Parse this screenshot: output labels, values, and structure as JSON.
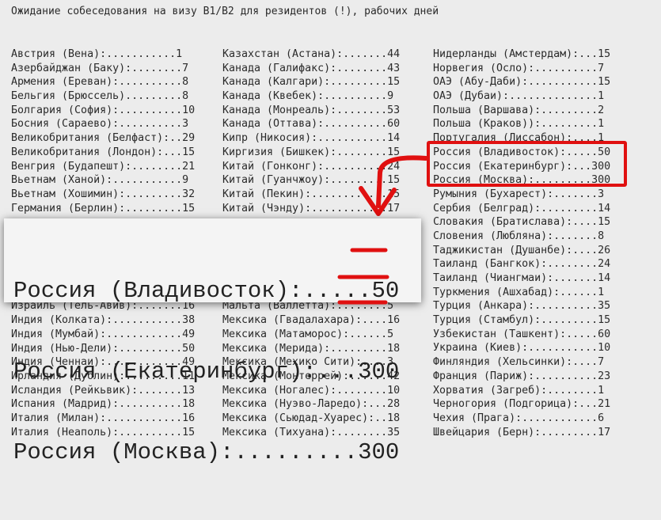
{
  "title": "Ожидание собеседования на визу B1/B2 для резидентов (!), рабочих дней",
  "columns": [
    [
      "Австрия (Вена):...........1",
      "Азербайджан (Баку):........7",
      "Армения (Ереван):..........8",
      "Бельгия (Брюссель).........8",
      "Болгария (София):..........10",
      "Босния (Сараево):..........3",
      "Великобритания (Белфаст):..29",
      "Великобритания (Лондон):...15",
      "Венгрия (Будапешт):........21",
      "Вьетнам (Ханой):...........9",
      "Вьетнам (Хошимин):.........32",
      "Германия (Берлин):.........15",
      "Израиль (Тель-Авив):.......16",
      "Индия (Колката):...........38",
      "Индия (Мумбай):............49",
      "Индия (Нью-Дели):..........50",
      "Индия (Ченнаи):............49",
      "Ирландия (Дублин):.........11",
      "Исландия (Рейкьвик):.......13",
      "Испания (Мадрид):..........18",
      "Италия (Милан):............16",
      "Италия (Неаполь):..........15"
    ],
    [
      "Казахстан (Астана):.......44",
      "Канада (Галифакс):........43",
      "Канада (Калгари):.........15",
      "Канада (Квебек):..........9",
      "Канада (Монреаль):........53",
      "Канада (Оттава):..........60",
      "Кипр (Никосия):...........14",
      "Киргизия (Бишкек):........15",
      "Китай (Гонконг):..........24",
      "Китай (Гуанчжоу):.........15",
      "Китай (Пекин):............15",
      "Китай (Чэнду):............17",
      "Мальта (Валлетта):........5",
      "Мексика (Гвадалахара):....16",
      "Мексика (Матаморос):......5",
      "Мексика (Мерида):.........18",
      "Мексика (Мехико Сити):....3",
      "Мексика (Монтеррей):......42",
      "Мексика (Ногалес):........10",
      "Мексика (Нуэво-Ларедо):...28",
      "Мексика (Сьюдад-Хуарес):..18",
      "Мексика (Тихуана):........35"
    ],
    [
      "Нидерланды (Амстердам):...15",
      "Норвегия (Осло):..........7",
      "ОАЭ (Абу-Даби):...........15",
      "ОАЭ (Дубаи):..............1",
      "Польша (Варшава):.........2",
      "Польша (Краков)):.........1",
      "Португалия (Лиссабон):....1",
      "Россия (Владивосток):.....50",
      "Россия (Екатеринбург):...300",
      "Россия (Москва):.........300",
      "Румыния (Бухарест):.......3",
      "Сербия (Белград):.........14",
      "Словакия (Братислава):....15",
      "Словения (Любляна):.......8",
      "Таджикистан (Душанбе):....26",
      "Таиланд (Бангкок):........24",
      "Таиланд (Чиангмаи):.......14",
      "Туркмения (Ашхабад):......1",
      "Турция (Анкара):..........35",
      "Турция (Стамбул):.........15",
      "Узбекистан (Ташкент):.....60",
      "Украина (Киев):...........10",
      "Финляндия (Хельсинки):....7",
      "Франция (Париж):..........23",
      "Хорватия (Загреб):........1",
      "Черногория (Подгорица):...21",
      "Чехия (Прага):............6",
      "Швейцария (Берн):.........17"
    ]
  ],
  "zoom": [
    {
      "label": "Россия (Владивосток):.....",
      "value": "50"
    },
    {
      "label": "Россия (Екатеринбург):...",
      "value": "300"
    },
    {
      "label": "Россия (Москва):.........",
      "value": "300"
    }
  ],
  "accent_color": "#e01010"
}
